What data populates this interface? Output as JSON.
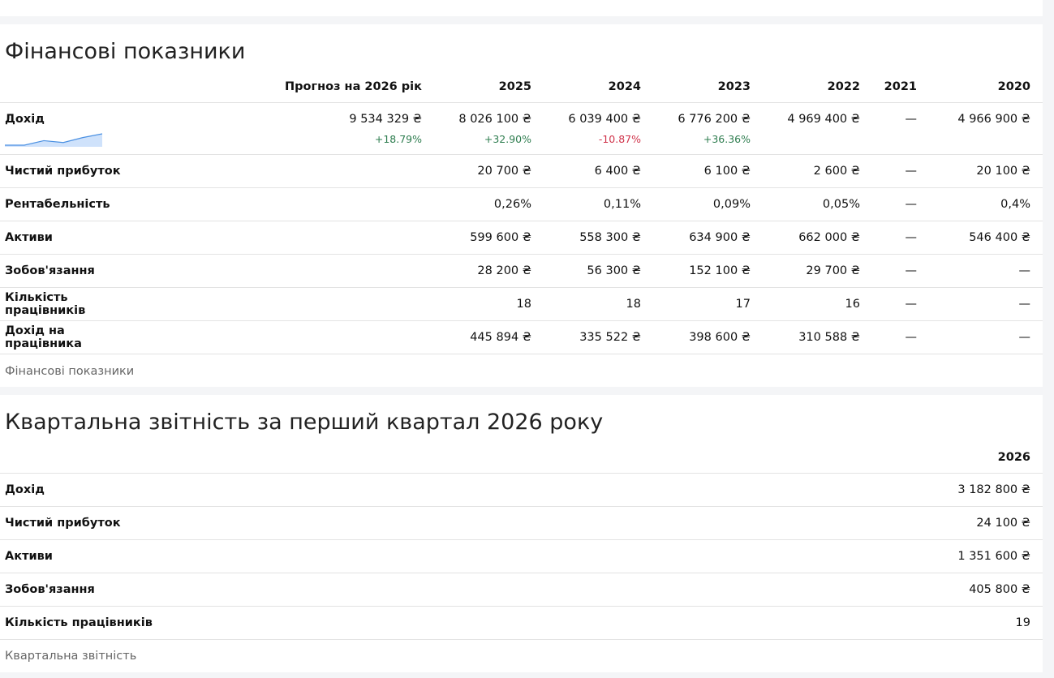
{
  "financials": {
    "title": "Фінансові показники",
    "caption": "Фінансові показники",
    "columns": [
      "Прогноз на 2026 рік",
      "2025",
      "2024",
      "2023",
      "2022",
      "2021",
      "2020"
    ],
    "revenue": {
      "label": "Дохід",
      "values": [
        "9 534 329 ₴",
        "8 026 100 ₴",
        "6 039 400 ₴",
        "6 776 200 ₴",
        "4 969 400 ₴",
        "—",
        "4 966 900 ₴"
      ],
      "changes": [
        "+18.79%",
        "+32.90%",
        "-10.87%",
        "+36.36%",
        "",
        "",
        ""
      ],
      "change_dirs": [
        "up",
        "up",
        "down",
        "up",
        "",
        "",
        ""
      ],
      "sparkline": [
        4966900,
        4969400,
        6776200,
        6039400,
        8026100,
        9534329
      ]
    },
    "rows": [
      {
        "label": "Чистий прибуток",
        "values": [
          "",
          "20 700 ₴",
          "6 400 ₴",
          "6 100 ₴",
          "2 600 ₴",
          "—",
          "20 100 ₴"
        ]
      },
      {
        "label": "Рентабельність",
        "values": [
          "",
          "0,26%",
          "0,11%",
          "0,09%",
          "0,05%",
          "—",
          "0,4%"
        ]
      },
      {
        "label": "Активи",
        "values": [
          "",
          "599 600 ₴",
          "558 300 ₴",
          "634 900 ₴",
          "662 000 ₴",
          "—",
          "546 400 ₴"
        ]
      },
      {
        "label": "Зобов'язання",
        "values": [
          "",
          "28 200 ₴",
          "56 300 ₴",
          "152 100 ₴",
          "29 700 ₴",
          "—",
          "—"
        ]
      },
      {
        "label": "Кількість працівників",
        "values": [
          "",
          "18",
          "18",
          "17",
          "16",
          "—",
          "—"
        ]
      },
      {
        "label": "Дохід на працівника",
        "values": [
          "",
          "445 894 ₴",
          "335 522 ₴",
          "398 600 ₴",
          "310 588 ₴",
          "—",
          "—"
        ]
      }
    ]
  },
  "quarterly": {
    "title": "Квартальна звітність за перший квартал 2026 року",
    "caption": "Квартальна звітність",
    "columns": [
      "2026"
    ],
    "rows": [
      {
        "label": "Дохід",
        "values": [
          "3 182 800 ₴"
        ]
      },
      {
        "label": "Чистий прибуток",
        "values": [
          "24 100 ₴"
        ]
      },
      {
        "label": "Активи",
        "values": [
          "1 351 600 ₴"
        ]
      },
      {
        "label": "Зобов'язання",
        "values": [
          "405 800 ₴"
        ]
      },
      {
        "label": "Кількість працівників",
        "values": [
          "19"
        ]
      }
    ]
  },
  "colors": {
    "up": "#2e7d4f",
    "down": "#d0334a",
    "spark_fill": "#cfe2fb",
    "spark_line": "#4a90e2"
  }
}
